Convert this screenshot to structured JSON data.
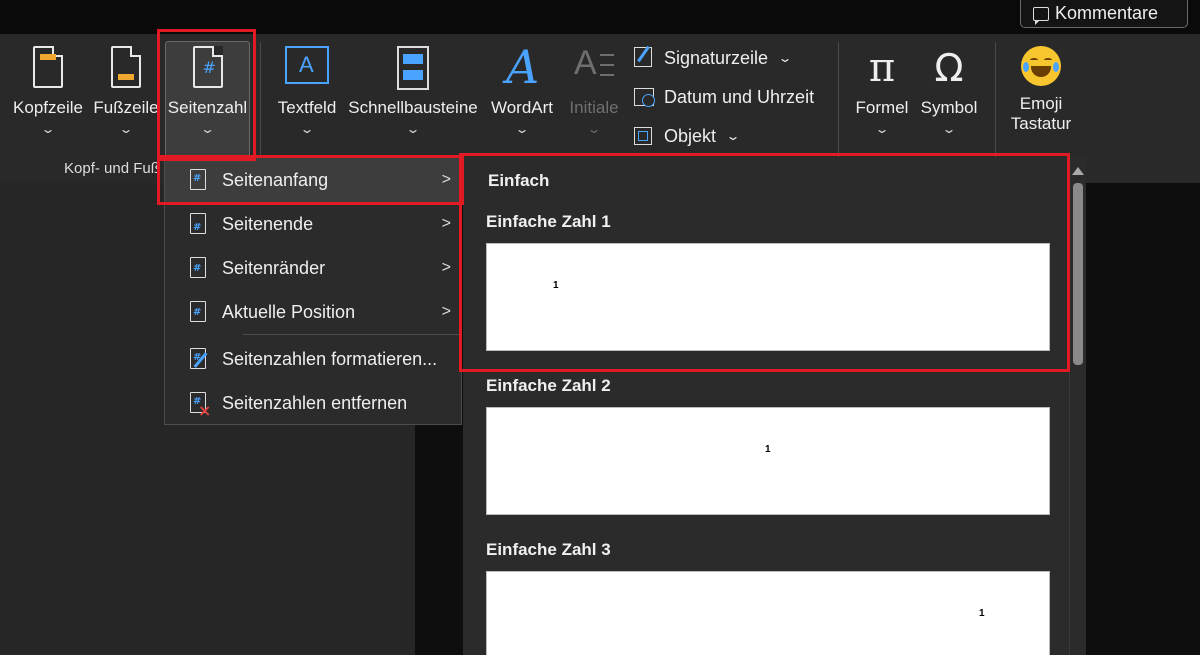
{
  "topbar": {
    "comments_label": "Kommentare"
  },
  "ribbon": {
    "kopfzeile": "Kopfzeile",
    "fusszeile": "Fußzeile",
    "seitenzahl": "Seitenzahl",
    "textfeld": "Textfeld",
    "schnellbausteine": "Schnellbausteine",
    "wordart": "WordArt",
    "initiale": "Initiale",
    "signaturzeile": "Signaturzeile",
    "datum": "Datum und Uhrzeit",
    "objekt": "Objekt",
    "formel": "Formel",
    "symbol": "Symbol",
    "emoji_line1": "Emoji",
    "emoji_line2": "Tastatur",
    "group_kopf_fuss": "Kopf- und Fuß",
    "chevron": "⌄"
  },
  "menu": {
    "items": [
      {
        "label": "Seitenanfang",
        "submenu": true
      },
      {
        "label": "Seitenende",
        "submenu": true
      },
      {
        "label": "Seitenränder",
        "submenu": true
      },
      {
        "label": "Aktuelle Position",
        "submenu": true
      },
      {
        "label": "Seitenzahlen formatieren...",
        "submenu": false
      },
      {
        "label": "Seitenzahlen entfernen",
        "submenu": false
      }
    ],
    "arrow": ">"
  },
  "gallery": {
    "header": "Einfach",
    "options": [
      {
        "title": "Einfache Zahl 1",
        "number": "1",
        "align": "left"
      },
      {
        "title": "Einfache Zahl 2",
        "number": "1",
        "align": "center"
      },
      {
        "title": "Einfache Zahl 3",
        "number": "1",
        "align": "right"
      }
    ]
  },
  "colors": {
    "highlight": "#e01b24",
    "accent_blue": "#4aa3ff",
    "accent_orange": "#f0a830"
  }
}
